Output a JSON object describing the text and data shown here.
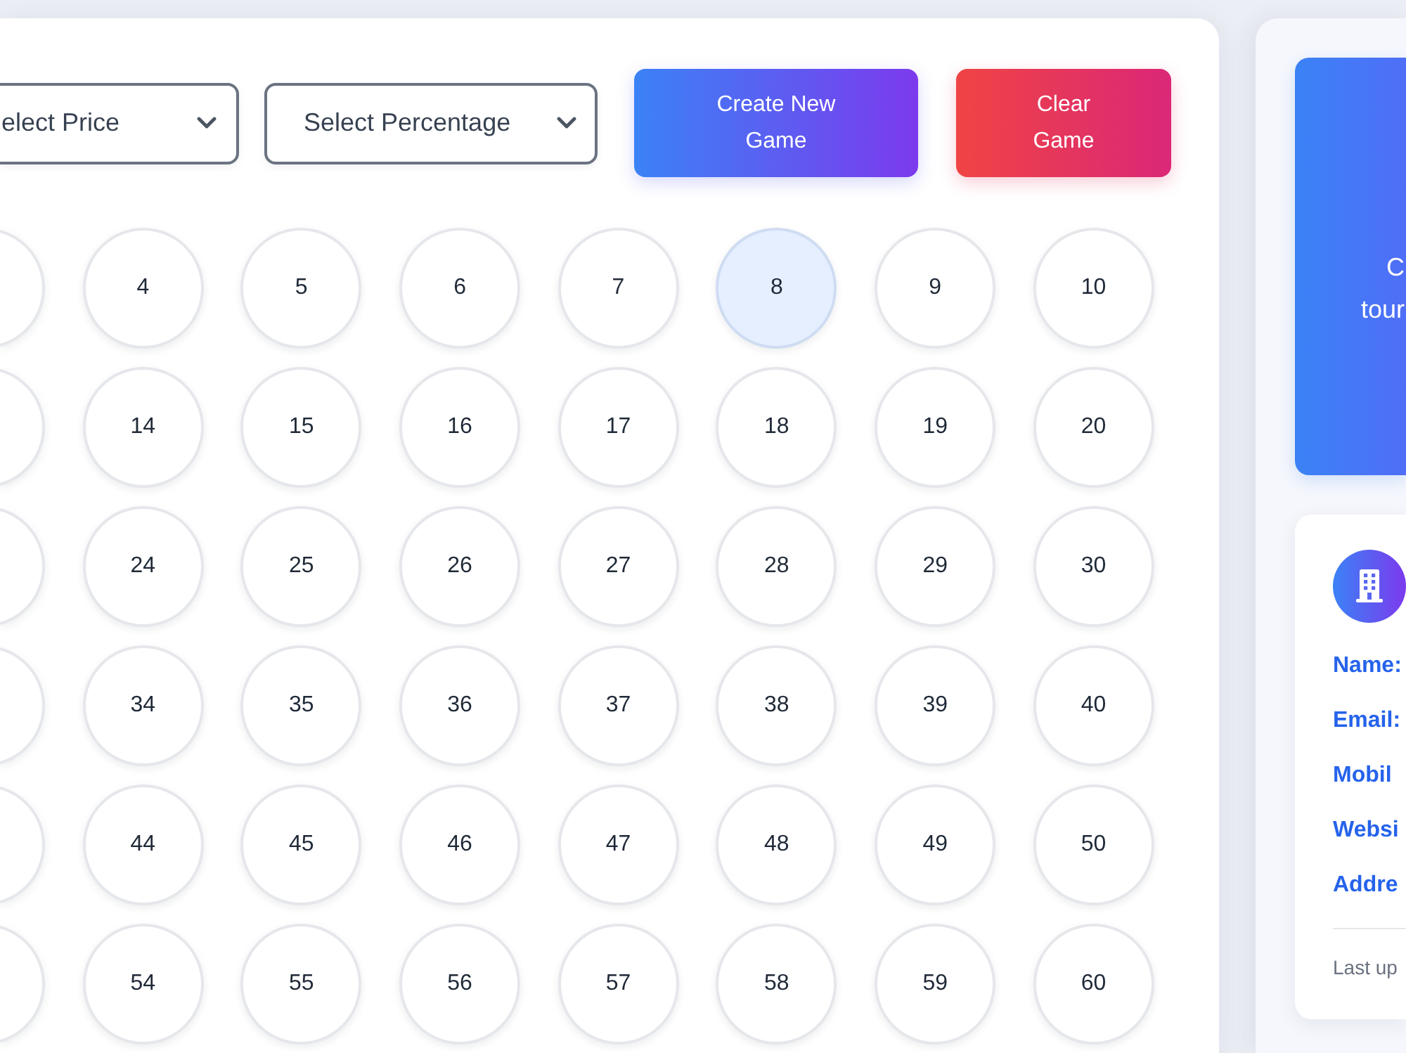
{
  "toolbar": {
    "selects": [
      {
        "label": "elect Price"
      },
      {
        "label": "Select Percentage"
      }
    ],
    "buttons": [
      {
        "label": "Create New Game",
        "kind": "primary"
      },
      {
        "label": "Clear Game",
        "kind": "danger"
      }
    ]
  },
  "number_grid": {
    "rows": [
      {
        "cells": [
          {
            "kind": "cut",
            "selected": false
          },
          {
            "kind": "number",
            "number": "4",
            "selected": false
          },
          {
            "kind": "number",
            "number": "5",
            "selected": false
          },
          {
            "kind": "number",
            "number": "6",
            "selected": false
          },
          {
            "kind": "number",
            "number": "7",
            "selected": false
          },
          {
            "kind": "number",
            "number": "8",
            "selected": true
          },
          {
            "kind": "number",
            "number": "9",
            "selected": false
          },
          {
            "kind": "number",
            "number": "10",
            "selected": false
          }
        ]
      },
      {
        "cells": [
          {
            "kind": "cut",
            "selected": false
          },
          {
            "kind": "number",
            "number": "14",
            "selected": false
          },
          {
            "kind": "number",
            "number": "15",
            "selected": false
          },
          {
            "kind": "number",
            "number": "16",
            "selected": false
          },
          {
            "kind": "number",
            "number": "17",
            "selected": false
          },
          {
            "kind": "number",
            "number": "18",
            "selected": false
          },
          {
            "kind": "number",
            "number": "19",
            "selected": false
          },
          {
            "kind": "number",
            "number": "20",
            "selected": false
          }
        ]
      },
      {
        "cells": [
          {
            "kind": "cut",
            "selected": false
          },
          {
            "kind": "number",
            "number": "24",
            "selected": false
          },
          {
            "kind": "number",
            "number": "25",
            "selected": false
          },
          {
            "kind": "number",
            "number": "26",
            "selected": false
          },
          {
            "kind": "number",
            "number": "27",
            "selected": false
          },
          {
            "kind": "number",
            "number": "28",
            "selected": false
          },
          {
            "kind": "number",
            "number": "29",
            "selected": false
          },
          {
            "kind": "number",
            "number": "30",
            "selected": false
          }
        ]
      },
      {
        "cells": [
          {
            "kind": "cut",
            "selected": false
          },
          {
            "kind": "number",
            "number": "34",
            "selected": false
          },
          {
            "kind": "number",
            "number": "35",
            "selected": false
          },
          {
            "kind": "number",
            "number": "36",
            "selected": false
          },
          {
            "kind": "number",
            "number": "37",
            "selected": false
          },
          {
            "kind": "number",
            "number": "38",
            "selected": false
          },
          {
            "kind": "number",
            "number": "39",
            "selected": false
          },
          {
            "kind": "number",
            "number": "40",
            "selected": false
          }
        ]
      },
      {
        "cells": [
          {
            "kind": "cut",
            "selected": false
          },
          {
            "kind": "number",
            "number": "44",
            "selected": false
          },
          {
            "kind": "number",
            "number": "45",
            "selected": false
          },
          {
            "kind": "number",
            "number": "46",
            "selected": false
          },
          {
            "kind": "number",
            "number": "47",
            "selected": false
          },
          {
            "kind": "number",
            "number": "48",
            "selected": false
          },
          {
            "kind": "number",
            "number": "49",
            "selected": false
          },
          {
            "kind": "number",
            "number": "50",
            "selected": false
          }
        ]
      },
      {
        "cells": [
          {
            "kind": "cut",
            "selected": false
          },
          {
            "kind": "number",
            "number": "54",
            "selected": false
          },
          {
            "kind": "number",
            "number": "55",
            "selected": false
          },
          {
            "kind": "number",
            "number": "56",
            "selected": false
          },
          {
            "kind": "number",
            "number": "57",
            "selected": false
          },
          {
            "kind": "number",
            "number": "58",
            "selected": false
          },
          {
            "kind": "number",
            "number": "59",
            "selected": false
          },
          {
            "kind": "number",
            "number": "60",
            "selected": false
          }
        ]
      }
    ]
  },
  "side_panel": {
    "banner": {
      "lines": [
        "C",
        "tour"
      ]
    },
    "info_card": {
      "fields": [
        "Name:",
        "Email:",
        "Mobil",
        "Websi",
        "Addre"
      ],
      "footer": "Last up"
    }
  }
}
